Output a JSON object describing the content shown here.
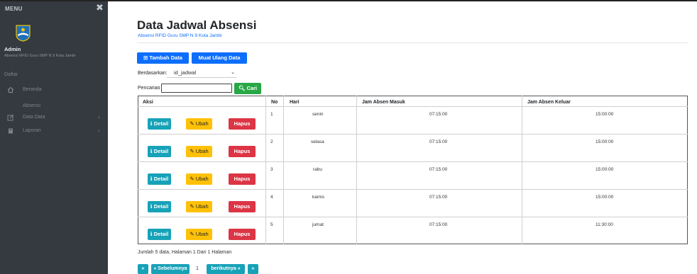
{
  "sidebar": {
    "menu_label": "MENU",
    "close_glyph": "✖",
    "admin_name": "Admin",
    "admin_sub": "Absensi RFID Guru SMP N 9 Kota Jambi",
    "section_label": "Daftar",
    "items": [
      {
        "label": "Beranda",
        "icon": "home-icon"
      },
      {
        "label": "Absensi",
        "icon": ""
      },
      {
        "label": "Data Data",
        "icon": "edit-icon"
      },
      {
        "label": "Laporan",
        "icon": "book-icon"
      }
    ]
  },
  "header": {
    "title": "Data Jadwal Absensi",
    "subtitle": "Absensi RFID Guru SMP N 9 Kota Jambi"
  },
  "toolbar": {
    "add_label": "Tambah Data",
    "reload_label": "Muat Ulang Data"
  },
  "filter": {
    "sort_label": "Berdasarkan:",
    "sort_value": "id_jadwal",
    "search_label": "Pencarian",
    "search_colon": ":",
    "search_value": "",
    "search_button": "Cari"
  },
  "table": {
    "headers": [
      "Aksi",
      "No",
      "Hari",
      "Jam Absen Masuk",
      "Jam Absen Keluar"
    ],
    "action_labels": {
      "detail": "Detail",
      "edit": "Ubah",
      "delete": "Hapus"
    },
    "rows": [
      {
        "no": "1",
        "hari": "senin",
        "masuk": "07:15:00",
        "keluar": "15:00:00"
      },
      {
        "no": "2",
        "hari": "selasa",
        "masuk": "07:15:00",
        "keluar": "15:00:00"
      },
      {
        "no": "3",
        "hari": "rabu",
        "masuk": "07:15:00",
        "keluar": "15:00:00"
      },
      {
        "no": "4",
        "hari": "kamis",
        "masuk": "07:15:00",
        "keluar": "15:00:00"
      },
      {
        "no": "5",
        "hari": "jumat",
        "masuk": "07:15:00",
        "keluar": "11:30:00"
      }
    ]
  },
  "footer": {
    "info": "Jumlah 5 data, Halaman 1 Dari 1 Halaman"
  },
  "pagination": {
    "first": "«",
    "prev": "« Sebelumnya",
    "current": "1",
    "next": "berikutnya »",
    "last": "»"
  },
  "colors": {
    "sidebar_bg": "#343a40",
    "primary": "#0d6efd",
    "info": "#17a2b8",
    "warning": "#ffc107",
    "danger": "#dc3545",
    "success": "#28a745"
  }
}
